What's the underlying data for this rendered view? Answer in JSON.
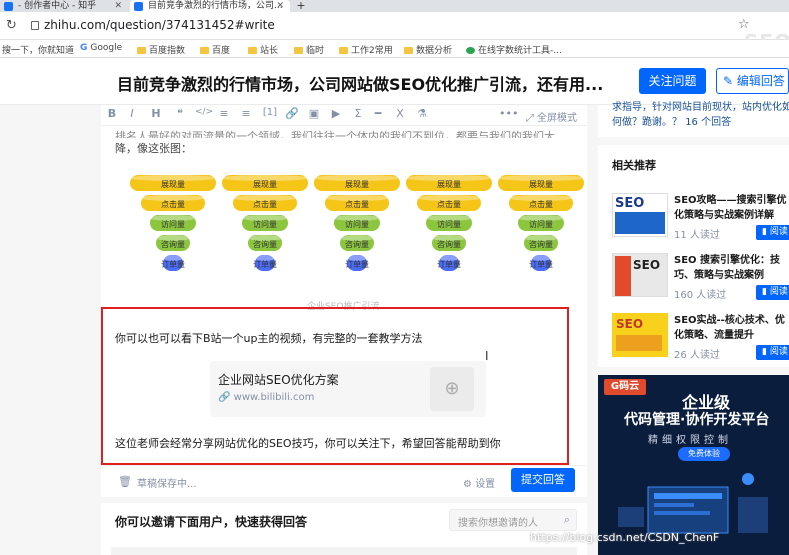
{
  "browser": {
    "tabs": [
      {
        "label": "- 创作者中心 - 知乎"
      },
      {
        "label": "目前竞争激烈的行情市场，公司..."
      }
    ],
    "url": "zhihu.com/question/374131452#write",
    "bookmarks": [
      "搜一下，你就知道",
      "Google",
      "百度指数",
      "百度",
      "站长",
      "临时",
      "工作2常用",
      "数据分析",
      "在线字数统计工具-..."
    ]
  },
  "header": {
    "question_title": "目前竞争激烈的行情市场，公司网站做SEO优化推广引流，还有用...",
    "follow_label": "关注问题",
    "edit_label": "编辑回答"
  },
  "editor": {
    "toolbar": {
      "items": [
        "B",
        "I",
        "H",
        "❝",
        "</>",
        "≡",
        "≡",
        "[1]",
        "🔗",
        "▣",
        "▶",
        "Σ",
        "━",
        "Ⅹ",
        "⚗",
        "•••"
      ],
      "fullscreen_label": "全屏模式"
    },
    "preceding_text_line1": "排名人最好的对面流量的一个领域，我们往往一个体内的我们不到位，都要与我们的我们大",
    "preceding_text_line2": "降，像这张图：",
    "funnel_labels": [
      "展现量",
      "点击量",
      "访问量",
      "咨询量",
      "订单量"
    ],
    "image_caption": "企业SEO推广引流",
    "answer_line1": "你可以也可以看下B站一个up主的视频，有完整的一套教学方法",
    "link_card": {
      "title": "企业网站SEO优化方案",
      "url": "www.bilibili.com"
    },
    "answer_line2": "这位老师会经常分享网站优化的SEO技巧，你可以关注下，希望回答能帮助到你",
    "draft_status": "草稿保存中...",
    "settings_label": "设置",
    "submit_label": "提交回答"
  },
  "invite": {
    "title": "你可以邀请下面用户，快速获得回答",
    "search_placeholder": "搜索你想邀请的人"
  },
  "sidebar": {
    "top_text_line1": "求指导，针对网站目前现状，站内优化如",
    "top_text_line2": "何做？跪谢。？ 16 个回答",
    "related_heading": "相关推荐",
    "related": [
      {
        "title": "SEO攻略——搜索引擎优化策略与实战案例详解（...",
        "meta": "11 人读过",
        "read_label": "阅读"
      },
      {
        "title": "SEO 搜索引擎优化：技巧、策略与实战案例",
        "meta": "160 人读过",
        "read_label": "阅读"
      },
      {
        "title": "SEO实战--核心技术、优化策略、流量提升",
        "meta": "26 人读过",
        "read_label": "阅读"
      }
    ],
    "ad": {
      "logo": "G码云",
      "line1": "企业级",
      "line2": "代码管理·协作开发平台",
      "line3": "精细权限控制",
      "button": "免费体验"
    }
  },
  "watermark": "https://blog.csdn.net/CSDN_ChenF",
  "colors": {
    "brand_blue": "#0066ff",
    "highlight_red": "#e02020",
    "funnel_yellow": "#f5c518",
    "funnel_green": "#8cc63f",
    "funnel_blue": "#4a6cf7"
  }
}
